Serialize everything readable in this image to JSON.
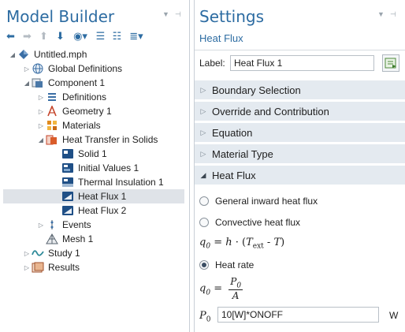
{
  "model_builder": {
    "title": "Model Builder",
    "toolbar": [
      "arrow-left-icon",
      "arrow-right-icon",
      "arrow-up-icon",
      "arrow-down-icon",
      "show-icon",
      "expand-sections-icon",
      "collapse-all-icon",
      "list-settings-icon"
    ],
    "tree": [
      {
        "label": "Untitled.mph",
        "icon": "model-root-icon"
      },
      {
        "label": "Global Definitions",
        "icon": "globe-icon"
      },
      {
        "label": "Component 1",
        "icon": "component-icon"
      },
      {
        "label": "Definitions",
        "icon": "definitions-icon"
      },
      {
        "label": "Geometry 1",
        "icon": "geometry-icon"
      },
      {
        "label": "Materials",
        "icon": "materials-icon"
      },
      {
        "label": "Heat Transfer in Solids",
        "icon": "heat-transfer-icon"
      },
      {
        "label": "Solid 1",
        "icon": "solid-icon"
      },
      {
        "label": "Initial Values 1",
        "icon": "initial-values-icon"
      },
      {
        "label": "Thermal Insulation 1",
        "icon": "thermal-insulation-icon"
      },
      {
        "label": "Heat Flux 1",
        "icon": "heat-flux-icon"
      },
      {
        "label": "Heat Flux 2",
        "icon": "heat-flux-icon"
      },
      {
        "label": "Events",
        "icon": "events-icon"
      },
      {
        "label": "Mesh 1",
        "icon": "mesh-icon"
      },
      {
        "label": "Study 1",
        "icon": "study-icon"
      },
      {
        "label": "Results",
        "icon": "results-icon"
      }
    ]
  },
  "settings": {
    "title": "Settings",
    "subtitle": "Heat Flux",
    "label_caption": "Label:",
    "label_value": "Heat Flux 1",
    "sections": [
      "Boundary Selection",
      "Override and Contribution",
      "Equation",
      "Material Type",
      "Heat Flux"
    ],
    "options": [
      "General inward heat flux",
      "Convective heat flux",
      "Heat rate"
    ],
    "selected_option": "Heat rate",
    "eq_convective": {
      "lhs": "q",
      "lhs_sub": "0",
      "rhs_h": "h",
      "text_var": "T",
      "text_sub": "ext",
      "t_var": "T"
    },
    "eq_rate": {
      "lhs": "q",
      "lhs_sub": "0",
      "num": "P",
      "num_sub": "0",
      "den": "A"
    },
    "p0": {
      "symbol": "P",
      "sub": "0",
      "value": "10[W]*ONOFF",
      "unit": "W"
    }
  },
  "colors": {
    "accent": "#2d6ca2",
    "section_bg": "#e4eaf0",
    "selected_row": "#dfe3e8"
  }
}
